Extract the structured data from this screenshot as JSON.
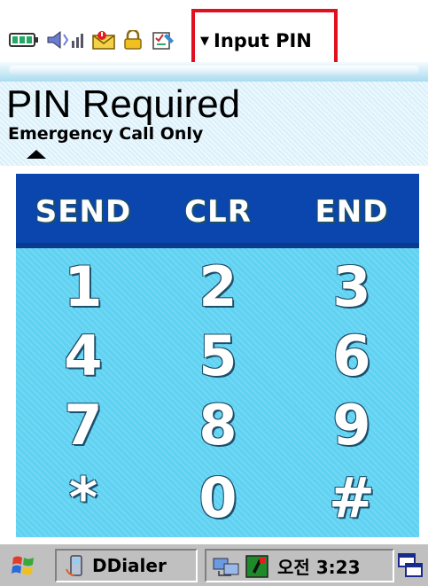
{
  "status_bar": {
    "icons": [
      "battery-icon",
      "sound-icon",
      "message-icon",
      "lock-icon",
      "tasks-icon"
    ],
    "title_menu": {
      "caret": "▼",
      "label": "Input PIN",
      "highlight_color": "#e0101e"
    }
  },
  "status_area": {
    "title": "PIN Required",
    "subtitle": "Emergency Call Only"
  },
  "keypad": {
    "function_keys": [
      "SEND",
      "CLR",
      "END"
    ],
    "digits": [
      "1",
      "2",
      "3",
      "4",
      "5",
      "6",
      "7",
      "8",
      "9",
      "*",
      "0",
      "#"
    ],
    "colors": {
      "function_row": "#0a46ad",
      "key_area": "#5fd2f2"
    }
  },
  "taskbar": {
    "start_icon": "windows-flag-icon",
    "task_button_label": "DDialer",
    "clock": "오전 3:23",
    "desktop_icon": "show-desktop-icon"
  }
}
